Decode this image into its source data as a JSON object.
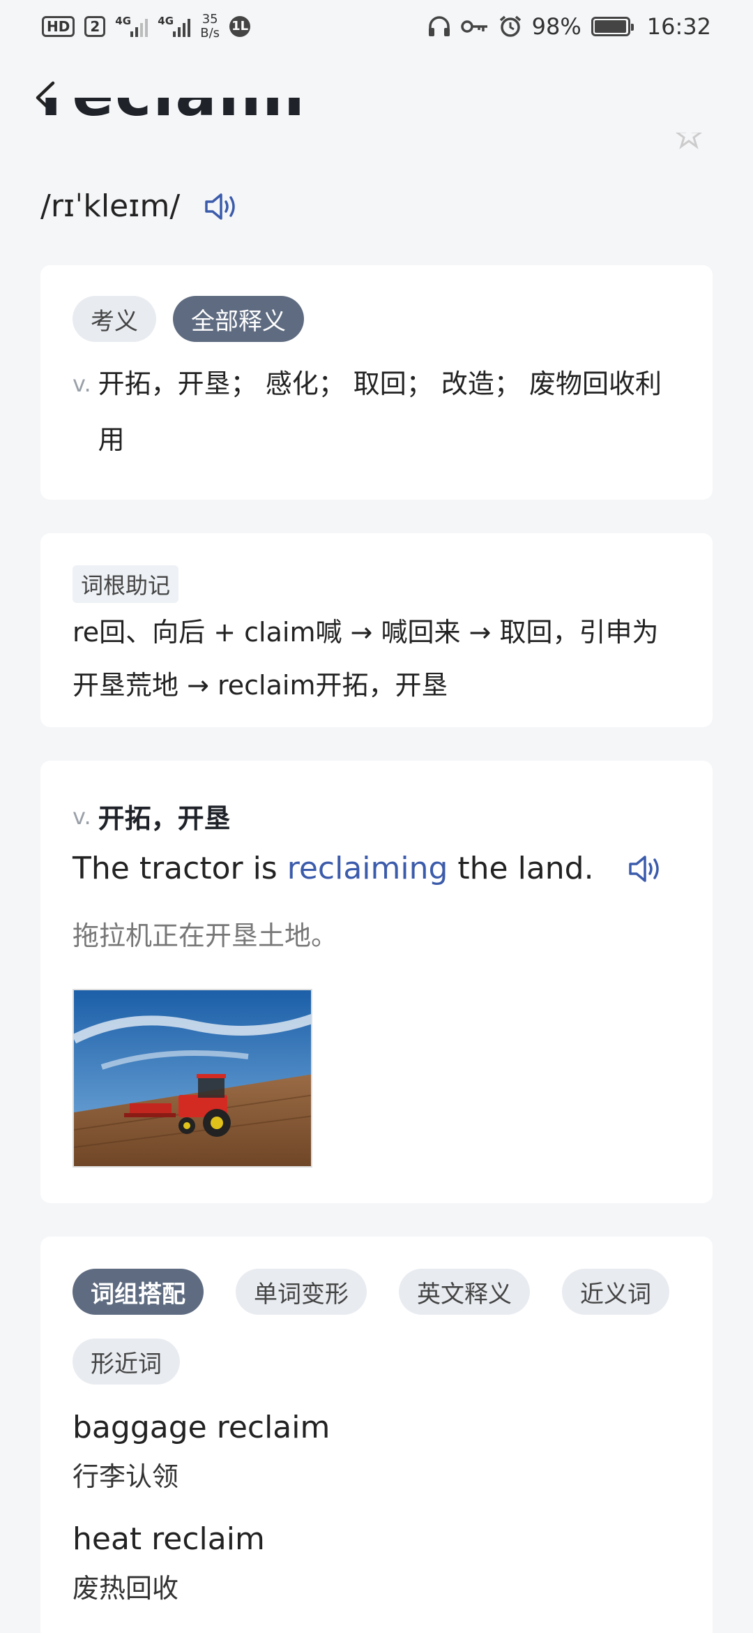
{
  "status_bar": {
    "hd": "HD",
    "sim": "2",
    "net1": "4G",
    "net2": "4G",
    "speed_value": "35",
    "speed_unit": "B/s",
    "badge": "1L",
    "battery_pct": "98%",
    "battery_level": 0.98,
    "time": "16:32"
  },
  "header": {
    "word": "reclaim",
    "phonetic": "/rɪˈkleɪm/"
  },
  "meaning_card": {
    "tabs": [
      {
        "label": "考义",
        "active": false
      },
      {
        "label": "全部释义",
        "active": true
      }
    ],
    "pos": "v.",
    "definition": "开拓，开垦；  感化；  取回；  改造；  废物回收利用"
  },
  "root_card": {
    "tag": "词根助记",
    "text": "re回、向后 + claim喊 → 喊回来 → 取回，引申为开垦荒地 → reclaim开拓，开垦"
  },
  "example_card": {
    "pos": "v.",
    "meaning": "开拓，开垦",
    "en_before": "The tractor is ",
    "en_highlight": "reclaiming",
    "en_after": " the land.",
    "zh": "拖拉机正在开垦土地。"
  },
  "phrase_card": {
    "tabs": [
      {
        "label": "词组搭配",
        "active": true
      },
      {
        "label": "单词变形",
        "active": false
      },
      {
        "label": "英文释义",
        "active": false
      },
      {
        "label": "近义词",
        "active": false
      },
      {
        "label": "形近词",
        "active": false
      }
    ],
    "items": [
      {
        "en": "baggage reclaim",
        "zh": "行李认领"
      },
      {
        "en": "heat reclaim",
        "zh": "废热回收"
      }
    ]
  },
  "colors": {
    "accent": "#3b5bab",
    "active_pill": "#5e6b80",
    "pill": "#e8ebf0"
  }
}
